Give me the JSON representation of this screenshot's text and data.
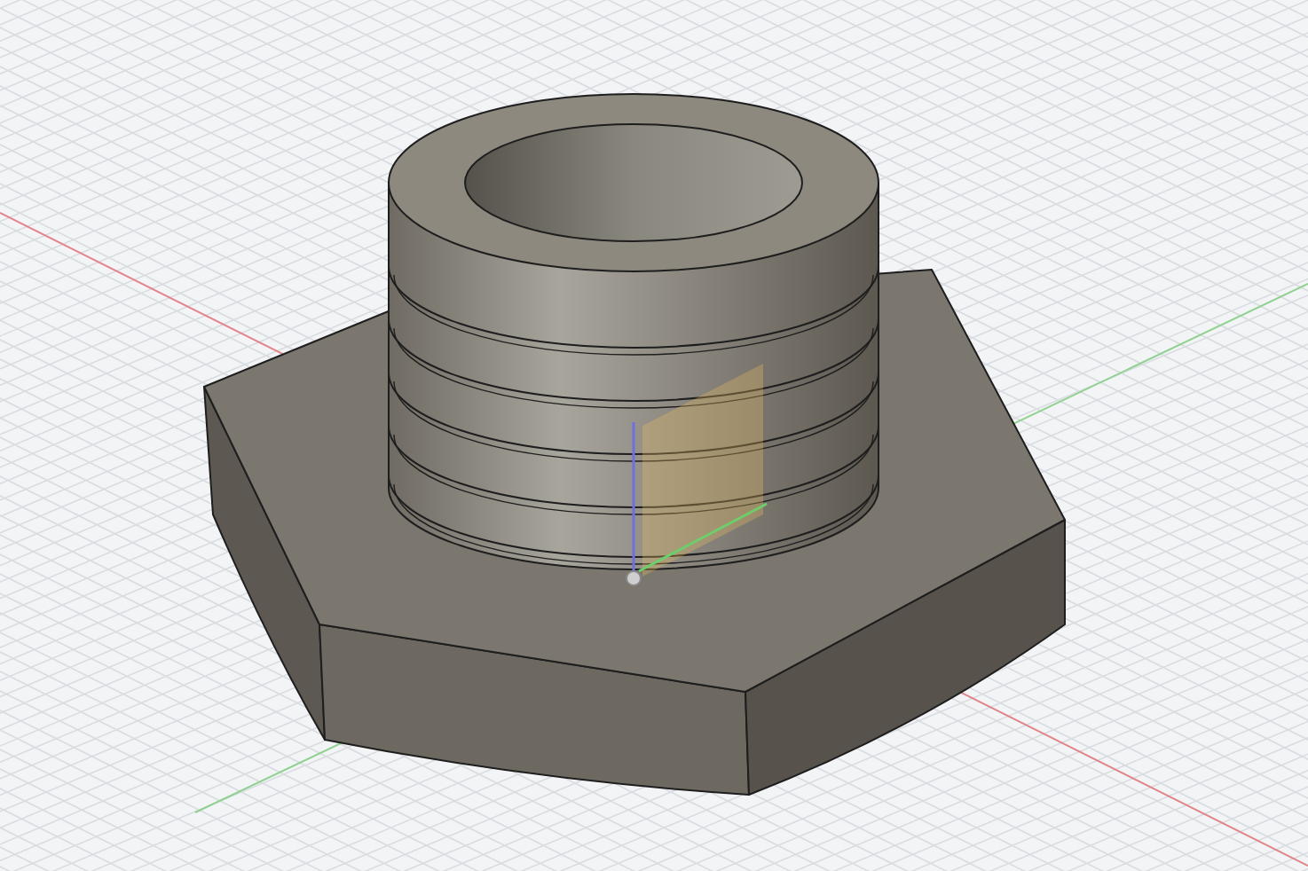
{
  "viewport": {
    "grid": true,
    "origin_axes": true
  }
}
